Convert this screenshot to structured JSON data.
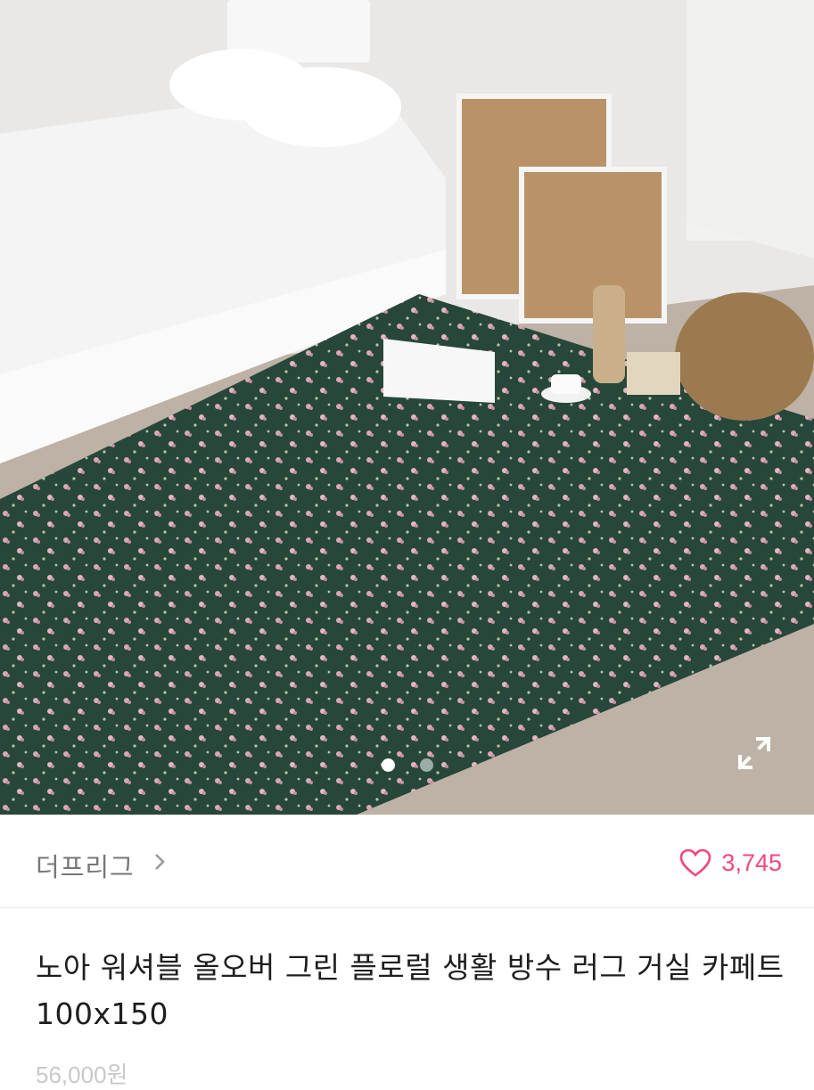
{
  "product": {
    "seller_name": "더프리그",
    "likes": "3,745",
    "title": "노아 워셔블 올오버 그린 플로럴 생활 방수 러그 거실 카페트 100x150",
    "price": "56,000원"
  },
  "gallery": {
    "image_count": 2,
    "active_index": 1
  },
  "colors": {
    "accent": "#f2487a",
    "rug": "#27473a"
  },
  "icons": {
    "expand": "expand-icon",
    "chevron": "chevron-right-icon",
    "heart": "heart-outline-icon"
  }
}
